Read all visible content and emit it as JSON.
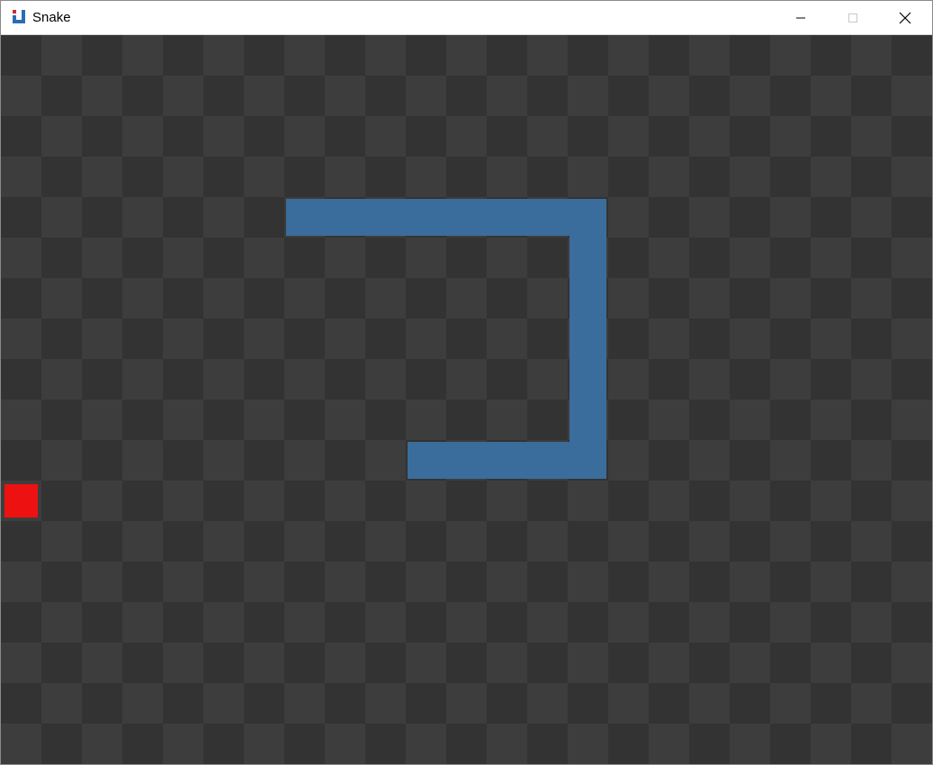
{
  "window": {
    "title": "Snake",
    "controls": {
      "minimize": "minimize",
      "maximize": "maximize",
      "close": "close"
    }
  },
  "game": {
    "grid": {
      "columns": 23,
      "rows": 18
    },
    "colors": {
      "tile_dark": "#333333",
      "tile_light": "#3d3d3d",
      "snake": "#3a6d9c",
      "food": "#ee1111"
    },
    "snake": [
      [
        10,
        10
      ],
      [
        11,
        10
      ],
      [
        12,
        10
      ],
      [
        13,
        10
      ],
      [
        14,
        10
      ],
      [
        14,
        9
      ],
      [
        14,
        8
      ],
      [
        14,
        7
      ],
      [
        14,
        6
      ],
      [
        14,
        5
      ],
      [
        14,
        4
      ],
      [
        13,
        4
      ],
      [
        12,
        4
      ],
      [
        11,
        4
      ],
      [
        10,
        4
      ],
      [
        9,
        4
      ],
      [
        8,
        4
      ],
      [
        7,
        4
      ]
    ],
    "food": [
      0,
      11
    ]
  }
}
